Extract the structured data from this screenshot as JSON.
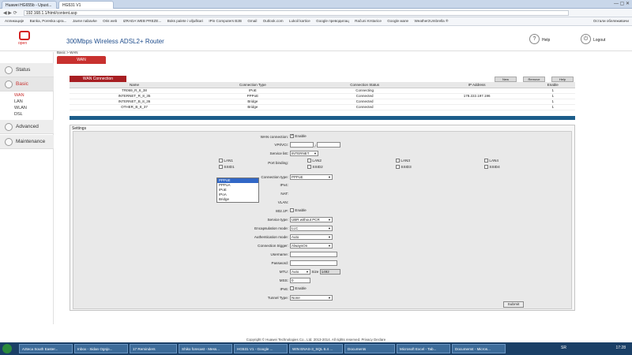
{
  "browser": {
    "tabs": [
      {
        "label": "Huawei HG655b - Upust..."
      },
      {
        "label": "HG531 V1"
      }
    ],
    "address": "192.168.1.1/html/content.asp",
    "bookmarks": [
      "Апликације",
      "Banka, Poreska upra...",
      "Javne nabavke",
      "Oris web",
      "IZRADA WEB PREZE...",
      "Boks palete i viljuškari",
      "IPin Computers B2B",
      "Gmail",
      "Outlook.com",
      "Lukoil kartice",
      "Google преводилац",
      "Računi Krstarice",
      "Google мапе",
      "Weather2Umbrella ®",
      "Остали обележивачи"
    ]
  },
  "header": {
    "logo_text": "open",
    "title": "300Mbps Wireless ADSL2+ Router",
    "help": "Help",
    "logout": "Logout"
  },
  "breadcrumb": "Basic > WAN",
  "subtab": "WAN",
  "sidebar": {
    "items": [
      {
        "label": "Status"
      },
      {
        "label": "Basic"
      },
      {
        "label": "Advanced"
      },
      {
        "label": "Maintenance"
      }
    ],
    "basic_sub": [
      "WAN",
      "LAN",
      "WLAN",
      "DSL"
    ]
  },
  "wan_table": {
    "title": "WAN Connection",
    "buttons": [
      "New",
      "Remove",
      "Help"
    ],
    "headers": [
      "Name",
      "Connection Type",
      "Connection Status",
      "IP Address",
      "Enable"
    ],
    "rows": [
      [
        "TR069_R_8_38",
        "IPoE",
        "Connecting",
        "",
        "1"
      ],
      [
        "INTERNET_R_8_35",
        "PPPoE",
        "Connected",
        "178.222.197.196",
        "1"
      ],
      [
        "INTERNET_B_8_36",
        "Bridge",
        "Connected",
        "",
        "1"
      ],
      [
        "OTHER_B_8_37",
        "Bridge",
        "Connected",
        "",
        "1"
      ]
    ]
  },
  "settings": {
    "title": "Settings",
    "wan_connection_label": "WAN connection:",
    "enable_label": "Enable",
    "vpi_label": "VPI/VCI:",
    "vpi_sep": "/",
    "service_list_label": "Service list:",
    "service_list_value": "INTERNET",
    "port_binding_label": "Port binding:",
    "ports": [
      "LAN1",
      "LAN2",
      "LAN3",
      "LAN4",
      "SSID1",
      "SSID2",
      "SSID3",
      "SSID4"
    ],
    "connection_type_label": "Connection type:",
    "connection_type_value": "PPPoE",
    "connection_type_options": [
      "PPPoE",
      "PPPoA",
      "IPoE",
      "IPoA",
      "Bridge"
    ],
    "ipv4_label": "IPv4:",
    "nat_label": "NAT:",
    "vlan_label": "VLAN:",
    "p8021_label": "802.1P:",
    "service_type_label": "Service type:",
    "service_type_value": "UBR without PCR",
    "encapsulation_label": "Encapsulation mode:",
    "encapsulation_value": "LLC",
    "auth_label": "Authentication mode:",
    "auth_value": "Auto",
    "trigger_label": "Connection trigger:",
    "trigger_value": "AlwaysOn",
    "username_label": "Username:",
    "password_label": "Password:",
    "mtu_label": "MTU:",
    "mtu_value": "Auto",
    "size_label": "Size",
    "size_value": "1492",
    "mss_label": "MSS:",
    "mss_value": "0",
    "ipv6_label": "IPv6:",
    "tunnel_label": "Tunnel Type:",
    "tunnel_value": "None",
    "submit": "Submit"
  },
  "footer": "Copyright © Huawei Technologies Co., Ltd. 2013-2014. All rights reserved. Privacy Declare",
  "taskbar": {
    "tasks": [
      "Azteca South Easter...",
      "Inbox - Sidan Ognjo...",
      "17 Reminders",
      "Shiko forecast - Mess...",
      "HG531 V1 - Google ...",
      "WIN ENAS-3_SQL 6.4 ...",
      "Documents",
      "Microsoft Excel - Tab...",
      "Document4 - Micros..."
    ],
    "lang": "SR",
    "clock": "17:28"
  }
}
